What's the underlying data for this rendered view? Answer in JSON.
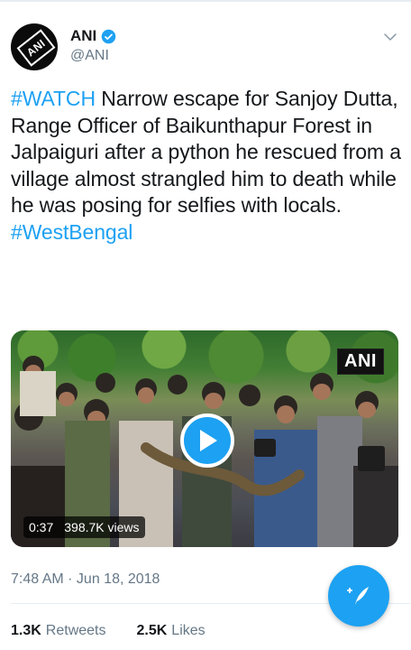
{
  "account": {
    "name": "ANI",
    "handle": "@ANI",
    "avatar_text": "ANI"
  },
  "tweet": {
    "hashtag_start": "#WATCH",
    "body": " Narrow escape for Sanjoy Dutta, Range Officer of Baikunthapur Forest in Jalpaiguri after a python he rescued from a village almost strangled him to death while he was posing for selfies with locals.",
    "hashtag_end": "#WestBengal"
  },
  "media": {
    "watermark": "ANI",
    "duration": "0:37",
    "views": "398.7K views"
  },
  "timestamp": "7:48 AM · Jun 18, 2018",
  "stats": {
    "retweets_count": "1.3K",
    "retweets_label": "Retweets",
    "likes_count": "2.5K",
    "likes_label": "Likes"
  },
  "colors": {
    "accent": "#1da1f2",
    "text": "#14171a",
    "secondary": "#657786"
  },
  "icons": [
    "verified-badge-icon",
    "chevron-down-icon",
    "play-icon",
    "compose-tweet-icon"
  ]
}
